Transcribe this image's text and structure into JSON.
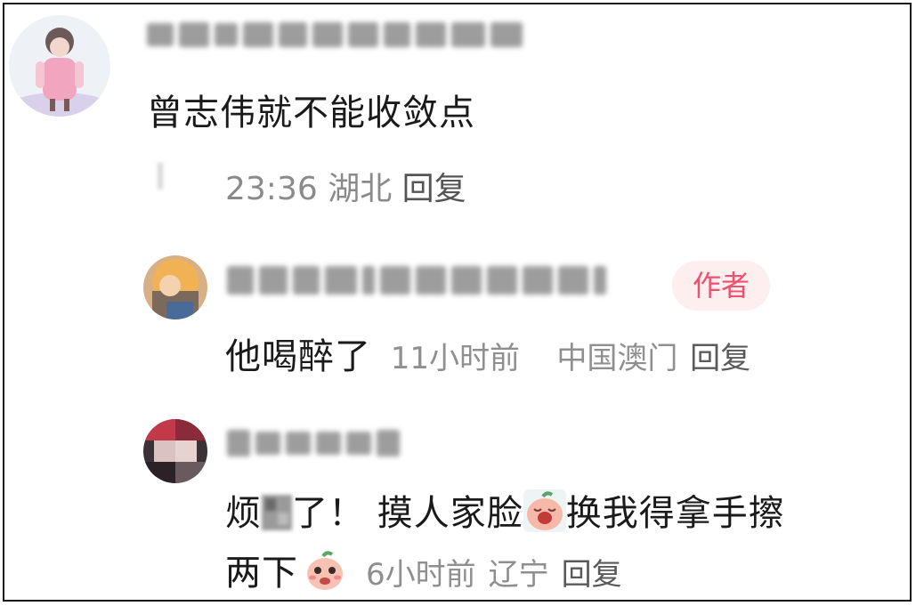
{
  "comments": [
    {
      "text": "曾志伟就不能收敛点",
      "time": "23:36",
      "location": "湖北",
      "reply_label": "回复",
      "avatar_icon": "girl-avatar-icon"
    },
    {
      "badge": "作者",
      "text": "他喝醉了",
      "time": "11小时前",
      "location": "中国澳门",
      "reply_label": "回复",
      "avatar_icon": "cartoon-avatar-icon"
    },
    {
      "text_part1": "烦",
      "text_part2": "了！ 摸人家脸",
      "text_part3": "换我得拿手擦",
      "text_line2": "两下",
      "time": "6小时前",
      "location": "辽宁",
      "reply_label": "回复",
      "avatar_icon": "photo-avatar-icon",
      "emojis": [
        "crying-peach-emoji-icon",
        "shy-peach-emoji-icon"
      ]
    }
  ],
  "colors": {
    "text": "#1a1a1a",
    "meta": "#8f8f8f",
    "badge_bg": "#fdeef0",
    "badge_text": "#f0506e",
    "border": "#1a1a1a"
  }
}
